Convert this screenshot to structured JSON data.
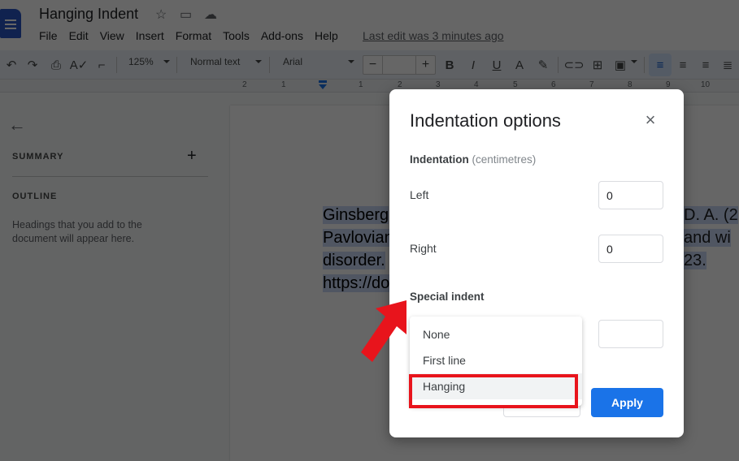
{
  "app": {
    "doc_title": "Hanging Indent",
    "title_icons": [
      "star-icon",
      "move-to-folder-icon",
      "cloud-saved-icon"
    ],
    "menu": [
      "File",
      "Edit",
      "View",
      "Insert",
      "Format",
      "Tools",
      "Add-ons",
      "Help"
    ],
    "last_edit": "Last edit was 3 minutes ago"
  },
  "toolbar": {
    "zoom": "125%",
    "style": "Normal text",
    "font": "Arial",
    "font_size": "",
    "minus": "−",
    "plus": "+",
    "buttons": [
      "undo",
      "redo",
      "print",
      "spellcheck",
      "paint-format",
      "bold",
      "italic",
      "underline",
      "text-color",
      "highlight",
      "link",
      "comment",
      "image",
      "align-left",
      "align-center",
      "align-right",
      "justify"
    ],
    "active_alignment": "align-left"
  },
  "ruler": {
    "labels": [
      "2",
      "1",
      "1",
      "2",
      "3",
      "4",
      "5",
      "6",
      "7",
      "8",
      "9",
      "10"
    ]
  },
  "sidebar": {
    "summary": "SUMMARY",
    "outline": "OUTLINE",
    "hint": "Headings that you add to the document will appear here."
  },
  "document": {
    "lines": [
      {
        "left": "Ginsberg",
        "right": "D. A. (2"
      },
      {
        "left": "Pavlovian",
        "right": "and wi"
      },
      {
        "left": "disorder.",
        "right": "23."
      },
      {
        "left": "https://do",
        "right": ""
      }
    ]
  },
  "dialog": {
    "title": "Indentation options",
    "subtitle_bold": "Indentation",
    "subtitle_unit": "(centimetres)",
    "left_label": "Left",
    "left_value": "0",
    "right_label": "Right",
    "right_value": "0",
    "special_label": "Special indent",
    "special_value": "",
    "dropdown_options": [
      "None",
      "First line",
      "Hanging"
    ],
    "hovered_option": "Hanging",
    "cancel_label": "",
    "apply_label": "Apply"
  },
  "annotation": {
    "highlight_color": "#e8141c",
    "highlighted_option": "Hanging"
  },
  "colors": {
    "primary": "#1a73e8",
    "docs_blue": "#2a56c6",
    "annotation_red": "#e8141c"
  }
}
